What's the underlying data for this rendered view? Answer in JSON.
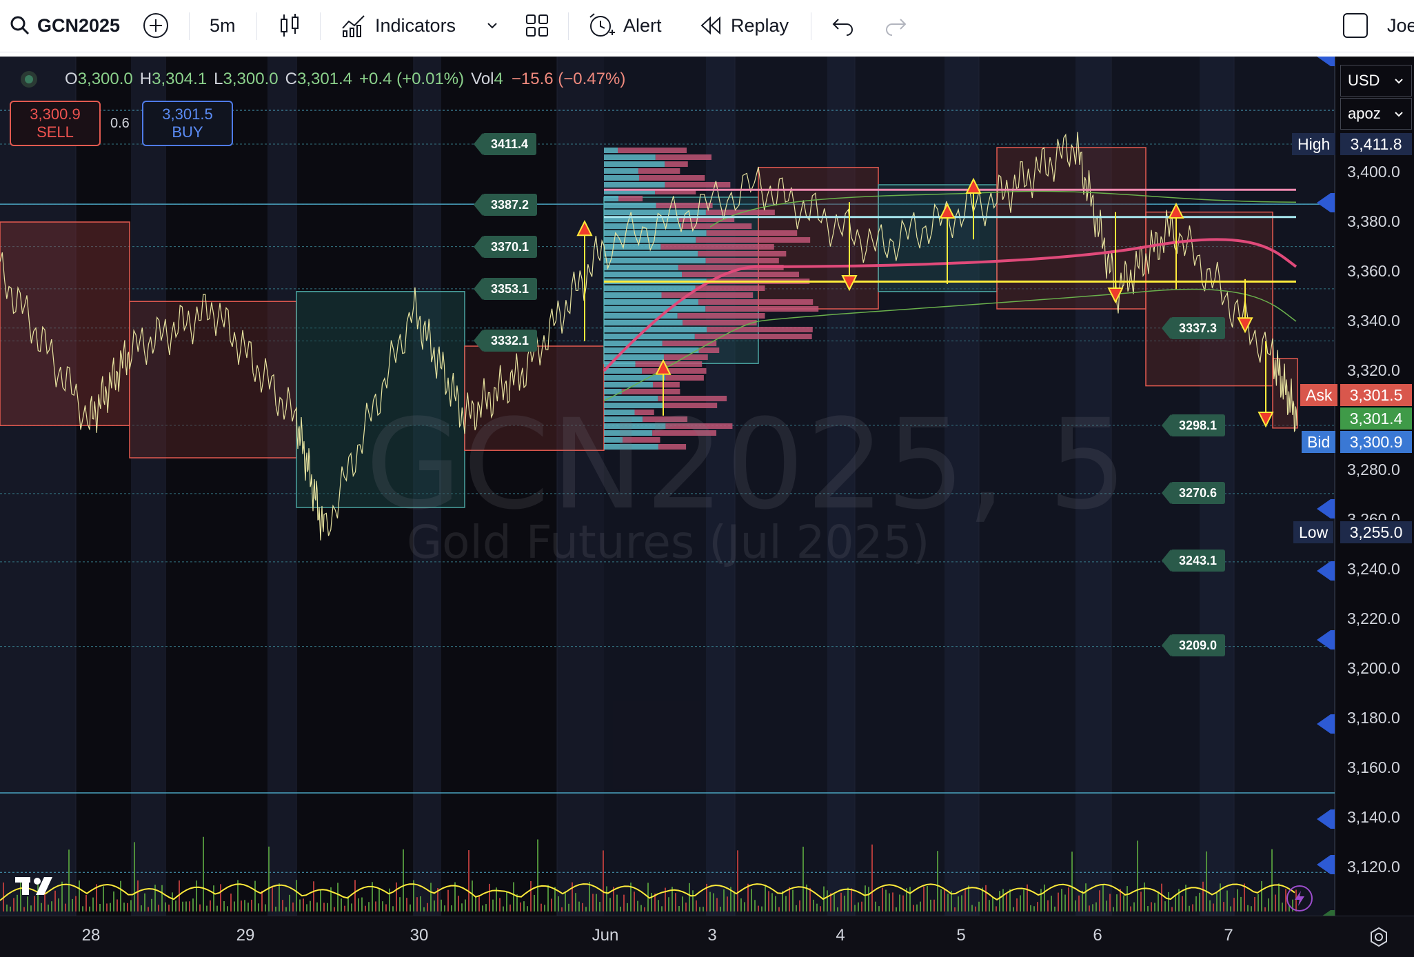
{
  "toolbar": {
    "symbol": "GCN2025",
    "interval": "5m",
    "indicators_label": "Indicators",
    "alert_label": "Alert",
    "replay_label": "Replay",
    "user_label": "Joe"
  },
  "legend": {
    "o_label": "O",
    "o_value": "3,300.0",
    "h_label": "H",
    "h_value": "3,304.1",
    "l_label": "L",
    "l_value": "3,300.0",
    "c_label": "C",
    "c_value": "3,301.4",
    "change": "+0.4 (+0.01%)",
    "vol_label": "Vol",
    "vol_value": "4",
    "extra": "−15.6 (−0.47%)"
  },
  "trade": {
    "sell_price": "3,300.9",
    "sell_label": "SELL",
    "spread": "0.6",
    "buy_price": "3,301.5",
    "buy_label": "BUY"
  },
  "watermark": {
    "symbol_line": "GCN2025, 5",
    "name_line": "Gold Futures (Jul 2025)"
  },
  "price_axis": {
    "currency": "USD",
    "layout_menu": "apoz",
    "ticks": [
      "3,400.0",
      "3,380.0",
      "3,360.0",
      "3,340.0",
      "3,320.0",
      "3,280.0",
      "3,260.0",
      "3,240.0",
      "3,220.0",
      "3,200.0",
      "3,180.0",
      "3,160.0",
      "3,140.0",
      "3,120.0"
    ],
    "high_label": "High",
    "high_value": "3,411.8",
    "low_label": "Low",
    "low_value": "3,255.0",
    "ask_label": "Ask",
    "ask_value": "3,301.5",
    "last_value": "3,301.4",
    "bid_label": "Bid",
    "bid_value": "3,300.9"
  },
  "level_labels": [
    "3411.4",
    "3387.2",
    "3370.1",
    "3353.1",
    "3332.1",
    "3337.3",
    "3298.1",
    "3270.6",
    "3243.1",
    "3209.0"
  ],
  "time_axis": [
    "28",
    "29",
    "30",
    "Jun",
    "3",
    "4",
    "5",
    "6",
    "7"
  ],
  "colors": {
    "background": "#0b0b11",
    "up": "#26a69a",
    "down": "#ef5350",
    "level_label_bg": "#2a5a4a",
    "poc": "#ffeb3b",
    "vwap": "#e04a7a"
  },
  "chart_data": {
    "type": "line",
    "title": "GCN2025, 5",
    "subtitle": "Gold Futures (Jul 2025)",
    "x": [
      "28",
      "29",
      "30",
      "Jun",
      "3",
      "4",
      "5",
      "6",
      "7"
    ],
    "series": [
      {
        "values": [
          3360,
          3300,
          3340,
          3255,
          3330,
          3310,
          3370,
          3395,
          3345,
          3375,
          3360,
          3411,
          3355,
          3378,
          3301
        ]
      }
    ],
    "ylim": [
      3110,
      3425
    ],
    "levels": [
      3411.4,
      3387.2,
      3370.1,
      3353.1,
      3332.1,
      3337.3,
      3298.1,
      3270.6,
      3243.1,
      3209.0
    ],
    "high": 3411.8,
    "low": 3255.0
  }
}
